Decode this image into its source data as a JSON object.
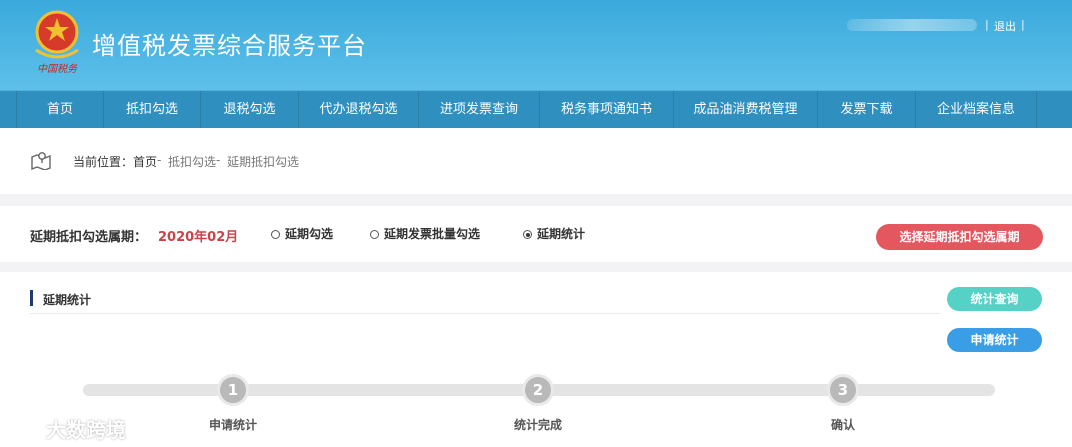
{
  "header": {
    "title": "增值税发票综合服务平台",
    "emblem_caption": "中国税务",
    "separator": "|",
    "logout_label": "退出"
  },
  "nav": {
    "items": [
      {
        "label": "首页"
      },
      {
        "label": "抵扣勾选"
      },
      {
        "label": "退税勾选"
      },
      {
        "label": "代办退税勾选"
      },
      {
        "label": "进项发票查询"
      },
      {
        "label": "税务事项通知书"
      },
      {
        "label": "成品油消费税管理"
      },
      {
        "label": "发票下载"
      },
      {
        "label": "企业档案信息"
      }
    ]
  },
  "breadcrumb": {
    "label": "当前位置：",
    "home": "首页",
    "sep1": " - ",
    "level2": "抵扣勾选",
    "sep2": " - ",
    "current": "延期抵扣勾选"
  },
  "period": {
    "label": "延期抵扣勾选属期：",
    "value": "2020年02月",
    "options": [
      {
        "label": "延期勾选",
        "selected": false
      },
      {
        "label": "延期发票批量勾选",
        "selected": false
      },
      {
        "label": "延期统计",
        "selected": true
      }
    ],
    "select_button": "选择延期抵扣勾选属期"
  },
  "stats": {
    "title": "延期统计",
    "query_button": "统计查询",
    "apply_button": "申请统计",
    "steps": [
      {
        "number": "1",
        "label": "申请统计"
      },
      {
        "number": "2",
        "label": "统计完成"
      },
      {
        "number": "3",
        "label": "确认"
      }
    ]
  },
  "watermark": {
    "text": "大数跨境"
  },
  "colors": {
    "header": "#3aa9dc",
    "nav": "#2f8fbe",
    "danger_button": "#e4575e",
    "teal_button": "#55d1c6",
    "blue_button": "#3a9ee6",
    "period_value": "#c9434b"
  }
}
